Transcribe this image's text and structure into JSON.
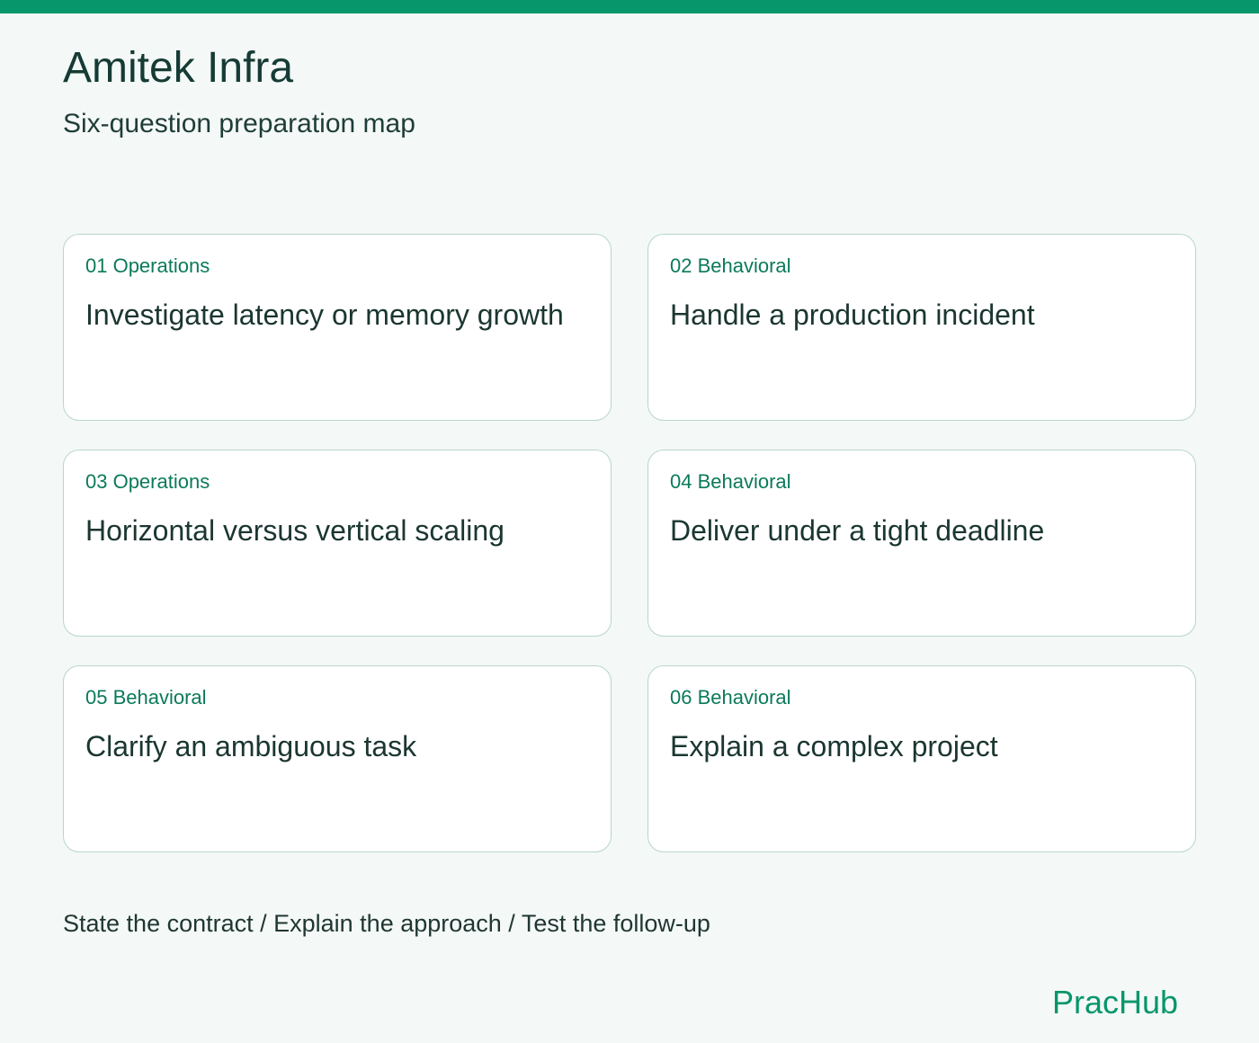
{
  "header": {
    "title": "Amitek Infra",
    "subtitle": "Six-question preparation map",
    "accent_color": "#07966b"
  },
  "cards": [
    {
      "tag": "01 Operations",
      "title": "Investigate latency or memory growth"
    },
    {
      "tag": "02 Behavioral",
      "title": "Handle a production incident"
    },
    {
      "tag": "03 Operations",
      "title": "Horizontal versus vertical scaling"
    },
    {
      "tag": "04 Behavioral",
      "title": "Deliver under a tight deadline"
    },
    {
      "tag": "05 Behavioral",
      "title": "Clarify an ambiguous task"
    },
    {
      "tag": "06 Behavioral",
      "title": "Explain a complex project"
    }
  ],
  "footer": {
    "steps": "State the contract / Explain the approach / Test the follow-up",
    "brand": "PracHub"
  }
}
